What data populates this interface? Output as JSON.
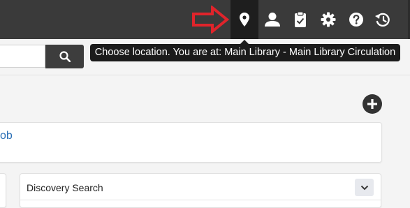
{
  "header": {
    "icons": [
      "location-pin-icon",
      "user-icon",
      "tasks-clipboard-icon",
      "settings-gear-icon",
      "help-icon",
      "history-icon"
    ]
  },
  "tooltip": {
    "text": "Choose location. You are at: Main Library - Main Library Circulation"
  },
  "search": {
    "value": "",
    "button_icon": "search-icon"
  },
  "widgets": {
    "partial_link_text": "ob",
    "discovery_search_title": "Discovery Search"
  },
  "colors": {
    "topbar": "#3a3a3a",
    "active_icon_bg": "#1e1e1e",
    "annotation_arrow": "#e0242b",
    "link": "#2a6fb6"
  }
}
